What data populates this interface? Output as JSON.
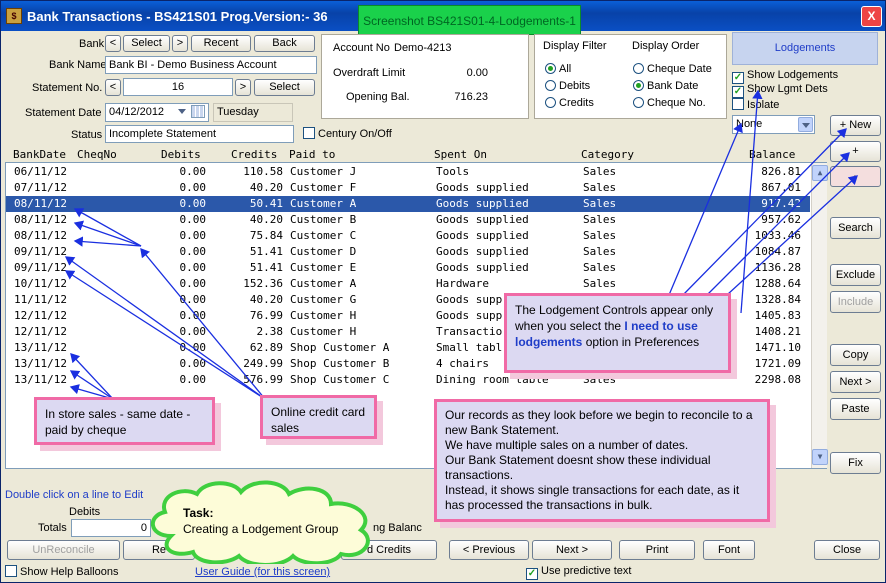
{
  "window": {
    "title": "Bank Transactions  -  BS421S01   Prog.Version:-  36",
    "screenshot_label": "Screenshot BS421S01-4-Lodgements-1",
    "close_glyph": "X",
    "app_icon": "bank-app-icon"
  },
  "bank": {
    "label": "Bank",
    "prev": "<",
    "select": "Select",
    "next": ">",
    "recent": "Recent",
    "back": "Back",
    "name_label": "Bank Name",
    "name_value": "Bank BI - Demo Business Account"
  },
  "statement": {
    "no_label": "Statement No.",
    "prev": "<",
    "no_value": "16",
    "next": ">",
    "select": "Select",
    "date_label": "Statement Date",
    "date_value": "04/12/2012",
    "day": "Tuesday",
    "status_label": "Status",
    "status_value": "Incomplete Statement",
    "century_label": "Century On/Off"
  },
  "account": {
    "no_label": "Account No",
    "no_value": "Demo-4213",
    "overdraft_label": "Overdraft Limit",
    "overdraft_value": "0.00",
    "opening_label": "Opening Bal.",
    "opening_value": "716.23"
  },
  "display_filter": {
    "title": "Display Filter",
    "options": [
      "All",
      "Debits",
      "Credits"
    ],
    "selected": "All"
  },
  "display_order": {
    "title": "Display Order",
    "options": [
      "Cheque Date",
      "Bank Date",
      "Cheque No."
    ],
    "selected": "Bank Date"
  },
  "lodgements": {
    "title": "Lodgements",
    "show_lodgements": "Show Lodgements",
    "show_lgmt_dets": "Show Lgmt Dets",
    "isolate": "Isolate",
    "dropdown_value": "None",
    "new_button": "+ New",
    "plus_button": "+",
    "minus_button": "-"
  },
  "grid": {
    "headers": {
      "bankdate": "BankDate",
      "chqno": "CheqNo",
      "debits": "Debits",
      "credits": "Credits",
      "paidto": "Paid to",
      "spenton": "Spent On",
      "category": "Category",
      "balance": "Balance"
    },
    "rows": [
      {
        "date": "06/11/12",
        "debit": "0.00",
        "credit": "110.58",
        "paid": "Customer J",
        "spent": "Tools",
        "cat": "Sales",
        "bal": "826.81"
      },
      {
        "date": "07/11/12",
        "debit": "0.00",
        "credit": "40.20",
        "paid": "Customer F",
        "spent": "Goods supplied",
        "cat": "Sales",
        "bal": "867.01"
      },
      {
        "date": "08/11/12",
        "debit": "0.00",
        "credit": "50.41",
        "paid": "Customer A",
        "spent": "Goods supplied",
        "cat": "Sales",
        "bal": "917.42"
      },
      {
        "date": "08/11/12",
        "debit": "0.00",
        "credit": "40.20",
        "paid": "Customer B",
        "spent": "Goods supplied",
        "cat": "Sales",
        "bal": "957.62"
      },
      {
        "date": "08/11/12",
        "debit": "0.00",
        "credit": "75.84",
        "paid": "Customer C",
        "spent": "Goods supplied",
        "cat": "Sales",
        "bal": "1033.46"
      },
      {
        "date": "09/11/12",
        "debit": "0.00",
        "credit": "51.41",
        "paid": "Customer D",
        "spent": "Goods supplied",
        "cat": "Sales",
        "bal": "1084.87"
      },
      {
        "date": "09/11/12",
        "debit": "0.00",
        "credit": "51.41",
        "paid": "Customer E",
        "spent": "Goods supplied",
        "cat": "Sales",
        "bal": "1136.28"
      },
      {
        "date": "10/11/12",
        "debit": "0.00",
        "credit": "152.36",
        "paid": "Customer A",
        "spent": "Hardware",
        "cat": "Sales",
        "bal": "1288.64"
      },
      {
        "date": "11/11/12",
        "debit": "0.00",
        "credit": "40.20",
        "paid": "Customer G",
        "spent": "Goods supp",
        "cat": "Sales",
        "bal": "1328.84"
      },
      {
        "date": "12/11/12",
        "debit": "0.00",
        "credit": "76.99",
        "paid": "Customer H",
        "spent": "Goods supp",
        "cat": "Sales",
        "bal": "1405.83"
      },
      {
        "date": "12/11/12",
        "debit": "0.00",
        "credit": "2.38",
        "paid": "Customer H",
        "spent": "Transactio",
        "cat": "Sales",
        "bal": "1408.21"
      },
      {
        "date": "13/11/12",
        "debit": "0.00",
        "credit": "62.89",
        "paid": "Shop Customer A",
        "spent": "Small tabl",
        "cat": "Sales",
        "bal": "1471.10"
      },
      {
        "date": "13/11/12",
        "debit": "0.00",
        "credit": "249.99",
        "paid": "Shop Customer B",
        "spent": "4 chairs",
        "cat": "Sales",
        "bal": "1721.09"
      },
      {
        "date": "13/11/12",
        "debit": "0.00",
        "credit": "576.99",
        "paid": "Shop Customer C",
        "spent": "Dining room table",
        "cat": "Sales",
        "bal": "2298.08"
      }
    ],
    "selected_index": 2
  },
  "side_buttons": {
    "search": "Search",
    "exclude": "Exclude",
    "include": "Include",
    "copy": "Copy",
    "next": "Next >",
    "paste": "Paste",
    "fix": "Fix"
  },
  "callouts": {
    "lodgement_controls_pre": "The Lodgement Controls appear only when you select the",
    "lodgement_controls_link": "I need to use lodgements",
    "lodgement_controls_post": "option in Preferences",
    "in_store": "In store sales - same date - paid by cheque",
    "online": "Online credit card sales",
    "records": "Our records as they look before we begin to reconcile to a new Bank Statement.\nWe have multiple sales on a number of dates.\nOur Bank Statement doesnt show these individual transactions.\nInstead, it shows single transactions for each date, as it has processed the transactions in bulk.",
    "task_title": "Task:",
    "task_text": "Creating a Lodgement Group"
  },
  "footer": {
    "double_click_hint": "Double click on a line to Edit",
    "debits_label": "Debits",
    "totals_label": "Totals",
    "debit_total": "0",
    "balance_partial": "ng Balanc",
    "unreconcile": "UnReconcile",
    "rec_partial": "Re",
    "add_credits_partial": "d Credits",
    "prev": "< Previous",
    "next": "Next >",
    "print": "Print",
    "font": "Font",
    "close": "Close",
    "show_help": "Show Help Balloons",
    "user_guide": "User Guide (for this screen)",
    "predictive": "Use predictive text"
  }
}
